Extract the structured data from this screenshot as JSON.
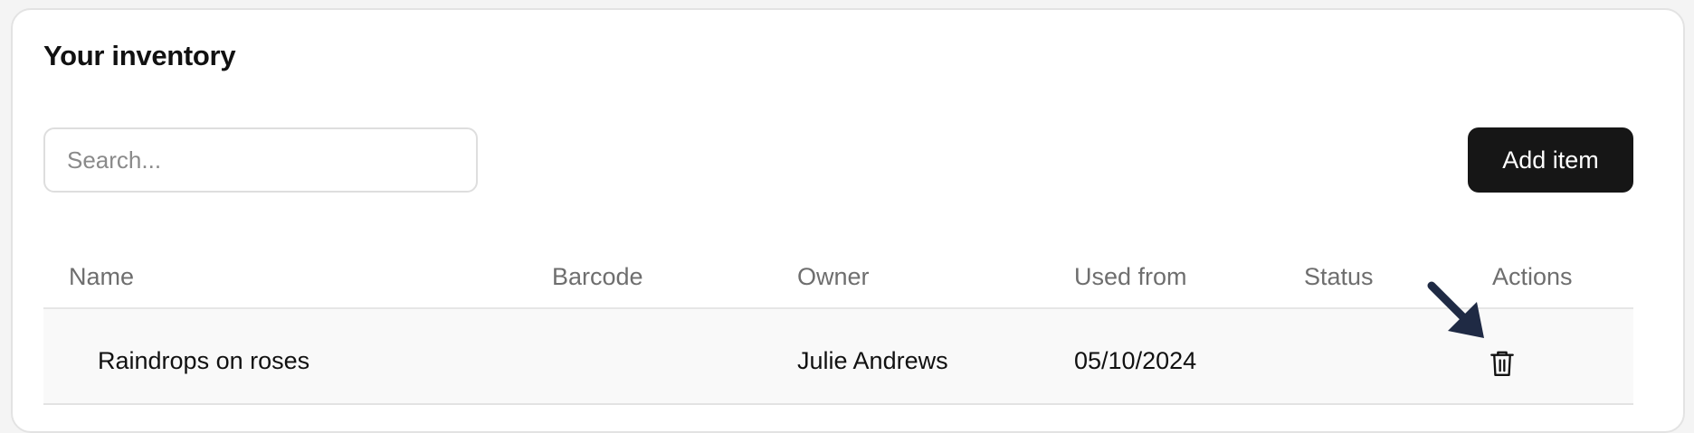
{
  "card": {
    "title": "Your inventory"
  },
  "toolbar": {
    "search_placeholder": "Search...",
    "search_value": "",
    "add_label": "Add item"
  },
  "table": {
    "columns": [
      "Name",
      "Barcode",
      "Owner",
      "Used from",
      "Status",
      "Actions"
    ],
    "rows": [
      {
        "name": "Raindrops on roses",
        "barcode": "",
        "owner": "Julie Andrews",
        "used_from": "05/10/2024",
        "status": "",
        "actions": [
          "trash-icon"
        ]
      }
    ]
  },
  "annotation": {
    "icon": "arrow-down-right-icon",
    "color": "#1f2a44"
  },
  "colors": {
    "button_bg": "#161616",
    "header_text": "#6e6e6e",
    "row_bg": "#f9f9f9"
  }
}
